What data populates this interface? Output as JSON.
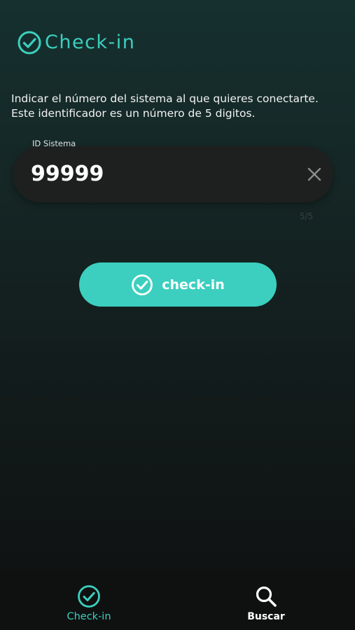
{
  "header": {
    "title": "Check-in",
    "icon": "check-circle-icon"
  },
  "instructions": {
    "line1": "Indicar el número del sistema al que quieres conectarte.",
    "line2": "Este identificador es un número de 5 digitos."
  },
  "system_id_field": {
    "label": "ID Sistema",
    "value": "99999",
    "counter": "5/5",
    "clear_icon": "close-icon"
  },
  "checkin_button": {
    "label": "check-in",
    "icon": "check-circle-icon"
  },
  "bottom_nav": {
    "items": [
      {
        "label": "Check-in",
        "icon": "check-circle-icon",
        "active": true
      },
      {
        "label": "Buscar",
        "icon": "search-icon",
        "active": false
      }
    ]
  },
  "colors": {
    "accent": "#3ccfbf",
    "field_bg": "#1e2020",
    "nav_bg": "#0f1111"
  }
}
